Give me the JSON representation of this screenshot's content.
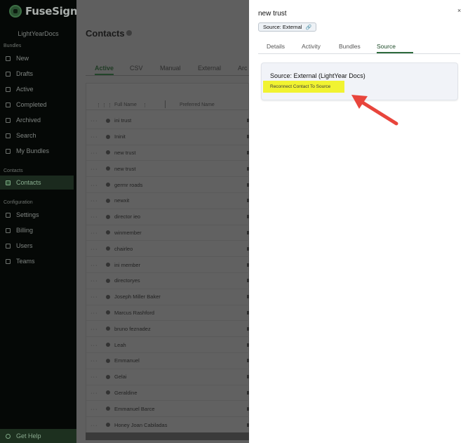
{
  "app": {
    "brand": "FuseSign",
    "org": "LightYearDocs"
  },
  "sidebar": {
    "sections": [
      {
        "label": "Bundles",
        "items": [
          {
            "label": "New",
            "icon": "plus-square-icon"
          },
          {
            "label": "Drafts",
            "icon": "folder-icon"
          },
          {
            "label": "Active",
            "icon": "folder-open-icon"
          },
          {
            "label": "Completed",
            "icon": "check-folder-icon"
          },
          {
            "label": "Archived",
            "icon": "archive-icon"
          },
          {
            "label": "Search",
            "icon": "search-icon"
          },
          {
            "label": "My Bundles",
            "icon": "bundle-icon"
          }
        ]
      },
      {
        "label": "Contacts",
        "items": [
          {
            "label": "Contacts",
            "icon": "contact-card-icon",
            "active": true
          }
        ]
      },
      {
        "label": "Configuration",
        "items": [
          {
            "label": "Settings",
            "icon": "gear-icon"
          },
          {
            "label": "Billing",
            "icon": "dollar-icon"
          },
          {
            "label": "Users",
            "icon": "user-icon"
          },
          {
            "label": "Teams",
            "icon": "team-icon"
          }
        ]
      }
    ],
    "help": "Get Help"
  },
  "main": {
    "title": "Contacts",
    "tabs": [
      "Active",
      "CSV",
      "Manual",
      "External",
      "Arc"
    ],
    "columns": [
      "Full Name",
      "Preferred Name"
    ],
    "rows": [
      "ini trust",
      "Ininit",
      "new trust",
      "new trust",
      "germr roads",
      "newxit",
      "director ieo",
      "winmember",
      "chairleo",
      "ini member",
      "directoryes",
      "Joseph Miller Baker",
      "Marcus Rashford",
      "bruno feznadez",
      "Leah",
      "Emmanuel",
      "Gelai",
      "Geraldine",
      "Emmanuel Barce",
      "Honey Joan Cabiladas"
    ]
  },
  "panel": {
    "title": "new trust",
    "chip_label": "Source: External",
    "close_label": "×",
    "tabs": [
      "Details",
      "Activity",
      "Bundles",
      "Source"
    ],
    "active_tab": "Source",
    "card_title": "Source: External (LightYear Docs)",
    "reconnect_label": "Reconnect Contact To Source"
  },
  "colors": {
    "accent": "#2d6a3c",
    "highlight": "#f1f331",
    "annotation_arrow": "#e8453c"
  }
}
